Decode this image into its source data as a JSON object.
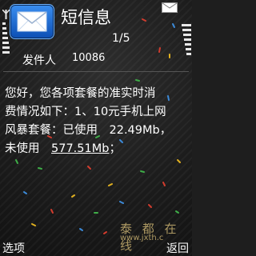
{
  "header": {
    "title": "短信息",
    "page_counter": "1/5"
  },
  "message": {
    "sender_label": "发件人",
    "sender_number": "10086",
    "lines": [
      "您好，您各项套餐的准实时消",
      "费情况如下：1、10元手机上网",
      "风暴套餐：已使用　22.49Mb，"
    ],
    "last_line_prefix": "未使用　",
    "last_line_link": "577.51Mb",
    "last_line_suffix": "；"
  },
  "softkeys": {
    "left_label": "选项",
    "right_label": "返回"
  },
  "watermark": {
    "chars": "泰 都 在 线",
    "url": "www.jxth.c"
  },
  "colors": {
    "background": "#1e1e1e",
    "icon_blue": "#1f6fd8",
    "text": "#ffffff",
    "watermark": "#c8b070"
  },
  "icons": [
    "message-app-icon",
    "envelope-status-icon",
    "signal-indicator",
    "battery-indicator"
  ]
}
